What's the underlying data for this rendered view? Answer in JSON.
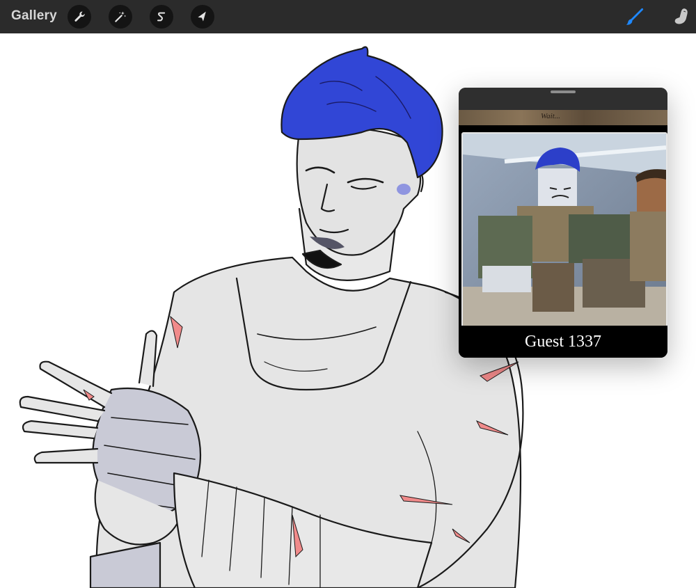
{
  "app": {
    "gallery_label": "Gallery"
  },
  "toolbar": {
    "left_tools": [
      {
        "name": "actions",
        "icon": "wrench-icon"
      },
      {
        "name": "adjustments",
        "icon": "magic-wand-icon"
      },
      {
        "name": "selection",
        "icon": "selection-s-icon"
      },
      {
        "name": "transform",
        "icon": "arrow-cursor-icon"
      }
    ],
    "right_tools": [
      {
        "name": "brush",
        "icon": "brush-icon",
        "active": true
      },
      {
        "name": "smudge",
        "icon": "smudge-finger-icon",
        "active": false
      }
    ],
    "colors": {
      "bar": "#2b2b2b",
      "active_tool": "#1e88ff",
      "inactive_tool": "#c8c8c8"
    }
  },
  "reference_panel": {
    "caption": "Guest 1337",
    "strip_text": "Wait..."
  },
  "artwork": {
    "colors": {
      "hair": "#3146d6",
      "skin": "#e6e6e6",
      "wrap": "#c9cad6",
      "scar": "#f08a8a",
      "line": "#1a1a1a"
    }
  }
}
